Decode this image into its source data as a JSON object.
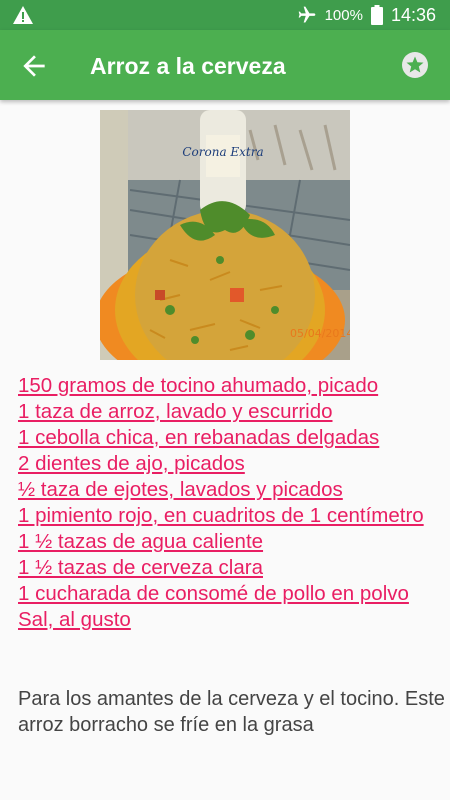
{
  "status_bar": {
    "battery_percent": "100%",
    "time": "14:36"
  },
  "app_bar": {
    "title": "Arroz a la cerveza"
  },
  "recipe": {
    "photo_label": "Corona Extra",
    "photo_date": "05/04/2014",
    "ingredients": [
      "150 gramos de tocino ahumado, picado",
      "1 taza de arroz, lavado y escurrido",
      "1 cebolla chica, en rebanadas delgadas",
      "2 dientes de ajo, picados",
      "½ taza de ejotes, lavados y picados",
      "1 pimiento rojo, en cuadritos de 1 centímetro",
      "1 ½ tazas de agua caliente",
      "1 ½ tazas de cerveza clara",
      "1 cucharada de consomé de pollo en polvo",
      "Sal, al gusto"
    ],
    "description": "Para los amantes de la cerveza y el tocino. Este arroz borracho se fríe en la grasa"
  },
  "colors": {
    "status_bar": "#3f9d4c",
    "app_bar": "#4caf50",
    "ingredient_link": "#e91e63",
    "description_text": "#444444"
  }
}
